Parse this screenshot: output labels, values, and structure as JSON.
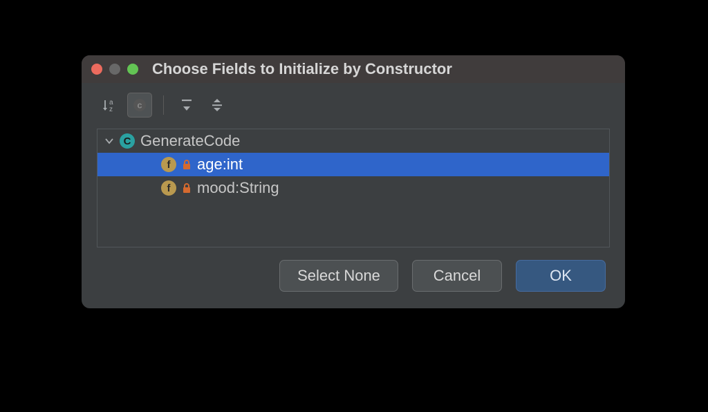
{
  "title": "Choose Fields to Initialize by Constructor",
  "className": "GenerateCode",
  "fields": [
    {
      "label": "age:int",
      "selected": true
    },
    {
      "label": "mood:String",
      "selected": false
    }
  ],
  "buttons": {
    "selectNone": "Select None",
    "cancel": "Cancel",
    "ok": "OK"
  }
}
